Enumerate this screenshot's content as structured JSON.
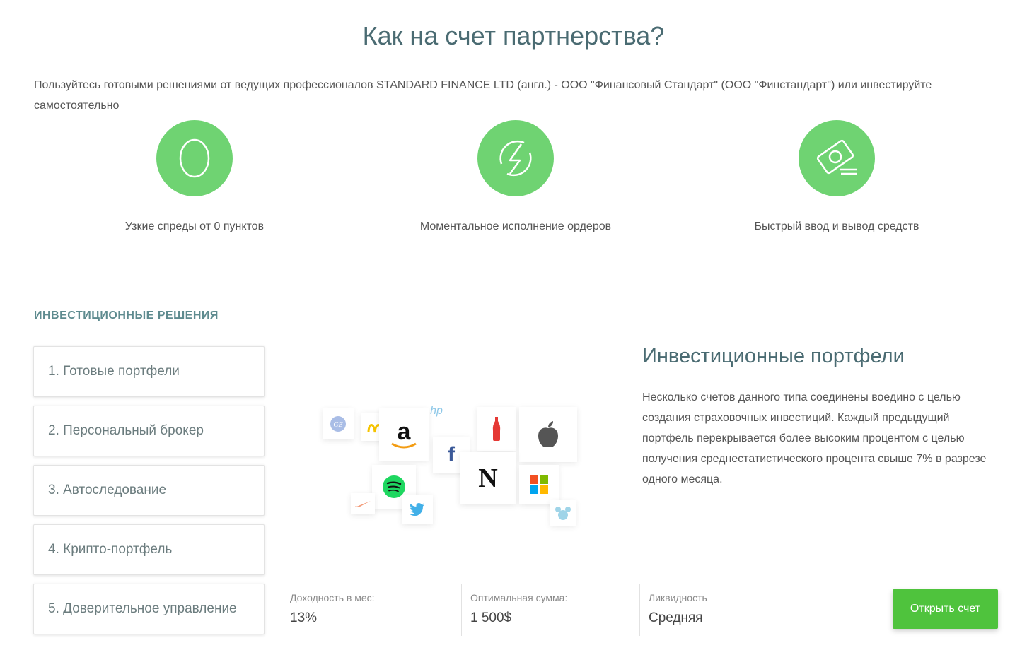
{
  "page_title": "Как на счет партнерства?",
  "intro_text": "Пользуйтесь готовыми решениями от ведущих профессионалов STANDARD FINANCE LTD (англ.) - ООО \"Финансовый Стандарт\" (ООО \"Финстандарт\") или инвестируйте самостоятельно",
  "features": [
    {
      "icon": "zero-icon",
      "caption": "Узкие спреды от 0 пунктов"
    },
    {
      "icon": "lightning-icon",
      "caption": "Моментальное исполнение ордеров"
    },
    {
      "icon": "money-icon",
      "caption": "Быстрый ввод и вывод средств"
    }
  ],
  "section_label": "ИНВЕСТИЦИОННЫЕ РЕШЕНИЯ",
  "tabs": [
    {
      "label": "1. Готовые портфели"
    },
    {
      "label": "2. Персональный брокер"
    },
    {
      "label": "3. Автоследование"
    },
    {
      "label": "4. Крипто-портфель"
    },
    {
      "label": "5. Доверительное управление"
    }
  ],
  "logos": {
    "hp": "hp",
    "amazon": "a",
    "facebook": "f",
    "netflix": "N"
  },
  "detail": {
    "title": "Инвестиционные портфели",
    "text": "Несколько счетов данного типа соединены воедино с целью создания страховочных инвестиций. Каждый предыдущий портфель перекрывается более высоким процентом с целью получения среднестатистического процента свыше 7% в разрезе одного месяца."
  },
  "stats": [
    {
      "label": "Доходность в мес:",
      "value": "13%"
    },
    {
      "label": "Оптимальная сумма:",
      "value": "1 500$"
    },
    {
      "label": "Ликвидность",
      "value": "Средняя"
    }
  ],
  "open_button": "Открыть счет",
  "colors": {
    "accent": "#6fd372",
    "button": "#4fc33d",
    "heading": "#4a6b72"
  }
}
